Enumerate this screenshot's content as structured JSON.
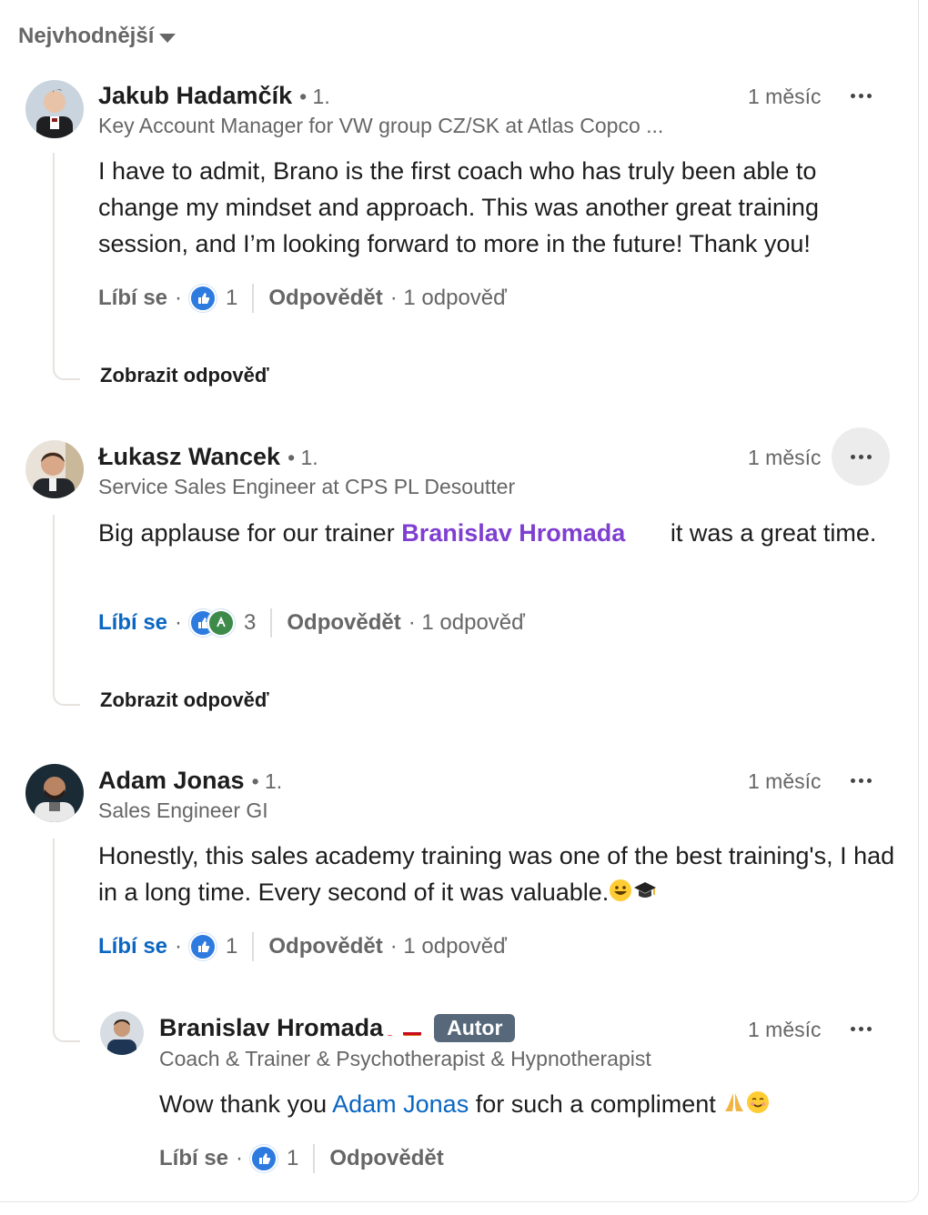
{
  "sort": {
    "label": "Nejvhodnější"
  },
  "comments": [
    {
      "author": "Jakub Hadamčík",
      "degree": "• 1.",
      "headline": "Key Account Manager for VW group CZ/SK at Atlas Copco ...",
      "time": "1 měsíc",
      "text": "I have to admit, Brano is the first coach who has truly been able to change my mindset and approach. This was another great training session, and I’m looking forward to more in the future! Thank you!",
      "like_label": "Líbí se",
      "reaction_count": "1",
      "reply_label": "Odpovědět",
      "replies_count": "· 1 odpověď",
      "show_replies": "Zobrazit odpověď"
    },
    {
      "author": "Łukasz Wancek",
      "degree": "• 1.",
      "headline": "Service Sales Engineer at CPS PL Desoutter",
      "time": "1 měsíc",
      "text_before": "Big applause for our trainer ",
      "mention": "Branislav Hromada",
      "text_after": " it was a great time.",
      "like_label": "Líbí se",
      "reaction_count": "3",
      "reply_label": "Odpovědět",
      "replies_count": "· 1 odpověď",
      "show_replies": "Zobrazit odpověď"
    },
    {
      "author": "Adam Jonas",
      "degree": "• 1.",
      "headline": "Sales Engineer GI",
      "time": "1 měsíc",
      "text": "Honestly, this sales academy training was one of the best training's, I had in a long time. Every second of it was valuable.",
      "like_label": "Líbí se",
      "reaction_count": "1",
      "reply_label": "Odpovědět",
      "replies_count": "· 1 odpověď"
    }
  ],
  "reply": {
    "author": "Branislav Hromada",
    "badge": "Autor",
    "headline": "Coach & Trainer & Psychotherapist & Hypnotherapist",
    "time": "1 měsíc",
    "text_before": "Wow thank you ",
    "mention": "Adam Jonas",
    "text_after": " for such a compliment ",
    "like_label": "Líbí se",
    "reaction_count": "1",
    "reply_label": "Odpovědět"
  },
  "colors": {
    "link": "#0a66c2",
    "mention_purple": "#7f3fd0",
    "muted": "#666666",
    "badge_bg": "#56687a"
  },
  "icons": [
    "caret-down-icon",
    "more-icon",
    "like-reaction-icon",
    "celebrate-reaction-icon",
    "flag-sk-icon",
    "flag-es-icon"
  ]
}
